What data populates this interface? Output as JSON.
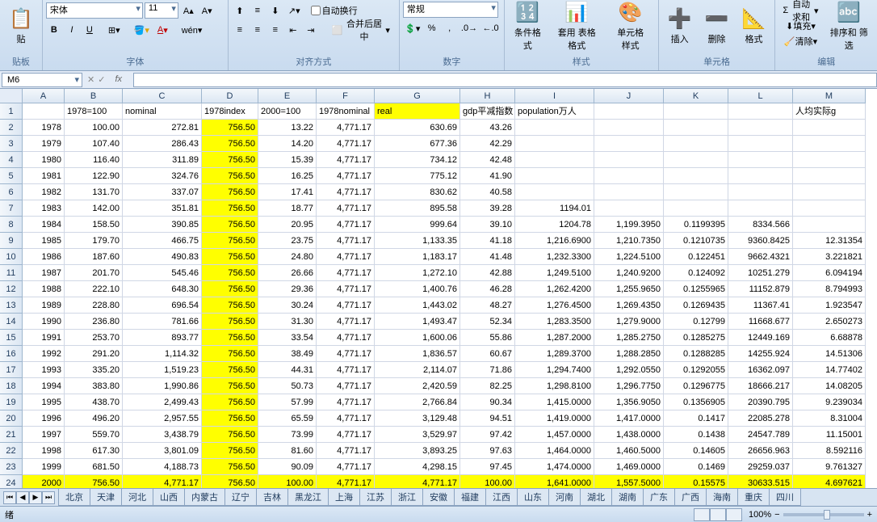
{
  "ribbon": {
    "clipboard": {
      "paste": "贴",
      "group": "贴板"
    },
    "font": {
      "name": "宋体",
      "size": "11",
      "group": "字体"
    },
    "alignment": {
      "wrap": "自动换行",
      "merge": "合并后居中",
      "group": "对齐方式"
    },
    "number": {
      "format": "常规",
      "group": "数字"
    },
    "styles": {
      "cond": "条件格式",
      "table": "套用\n表格格式",
      "cell": "单元格\n样式",
      "group": "样式"
    },
    "cells": {
      "insert": "插入",
      "delete": "删除",
      "format": "格式",
      "group": "单元格"
    },
    "editing": {
      "autosum": "自动求和",
      "fill": "填充",
      "clear": "清除",
      "sort": "排序和\n筛选",
      "group": "编辑"
    }
  },
  "namebox": "M6",
  "columns": [
    "A",
    "B",
    "C",
    "D",
    "E",
    "F",
    "G",
    "H",
    "I",
    "J",
    "K",
    "L",
    "M"
  ],
  "colwidths": [
    "colA",
    "colB",
    "colC",
    "colD",
    "colE",
    "colF",
    "colG",
    "colH",
    "colI",
    "colJ",
    "colK",
    "colL",
    "colM"
  ],
  "headers": {
    "B": "1978=100",
    "C": "nominal",
    "D": "1978index",
    "E": "2000=100",
    "F": "1978nominal",
    "G": "real",
    "H": "gdp平减指数",
    "I": "population万人",
    "M": "人均实际g"
  },
  "highlight_cols": [
    "D"
  ],
  "highlight_header_cols": [
    "G"
  ],
  "highlight_last_row": true,
  "rows": [
    {
      "A": "1978",
      "B": "100.00",
      "C": "272.81",
      "D": "756.50",
      "E": "13.22",
      "F": "4,771.17",
      "G": "630.69",
      "H": "43.26"
    },
    {
      "A": "1979",
      "B": "107.40",
      "C": "286.43",
      "D": "756.50",
      "E": "14.20",
      "F": "4,771.17",
      "G": "677.36",
      "H": "42.29"
    },
    {
      "A": "1980",
      "B": "116.40",
      "C": "311.89",
      "D": "756.50",
      "E": "15.39",
      "F": "4,771.17",
      "G": "734.12",
      "H": "42.48"
    },
    {
      "A": "1981",
      "B": "122.90",
      "C": "324.76",
      "D": "756.50",
      "E": "16.25",
      "F": "4,771.17",
      "G": "775.12",
      "H": "41.90"
    },
    {
      "A": "1982",
      "B": "131.70",
      "C": "337.07",
      "D": "756.50",
      "E": "17.41",
      "F": "4,771.17",
      "G": "830.62",
      "H": "40.58"
    },
    {
      "A": "1983",
      "B": "142.00",
      "C": "351.81",
      "D": "756.50",
      "E": "18.77",
      "F": "4,771.17",
      "G": "895.58",
      "H": "39.28",
      "I": "1194.01"
    },
    {
      "A": "1984",
      "B": "158.50",
      "C": "390.85",
      "D": "756.50",
      "E": "20.95",
      "F": "4,771.17",
      "G": "999.64",
      "H": "39.10",
      "I": "1204.78",
      "J": "1,199.3950",
      "K": "0.1199395",
      "L": "8334.566"
    },
    {
      "A": "1985",
      "B": "179.70",
      "C": "466.75",
      "D": "756.50",
      "E": "23.75",
      "F": "4,771.17",
      "G": "1,133.35",
      "H": "41.18",
      "I": "1,216.6900",
      "J": "1,210.7350",
      "K": "0.1210735",
      "L": "9360.8425",
      "M": "12.31354"
    },
    {
      "A": "1986",
      "B": "187.60",
      "C": "490.83",
      "D": "756.50",
      "E": "24.80",
      "F": "4,771.17",
      "G": "1,183.17",
      "H": "41.48",
      "I": "1,232.3300",
      "J": "1,224.5100",
      "K": "0.122451",
      "L": "9662.4321",
      "M": "3.221821"
    },
    {
      "A": "1987",
      "B": "201.70",
      "C": "545.46",
      "D": "756.50",
      "E": "26.66",
      "F": "4,771.17",
      "G": "1,272.10",
      "H": "42.88",
      "I": "1,249.5100",
      "J": "1,240.9200",
      "K": "0.124092",
      "L": "10251.279",
      "M": "6.094194"
    },
    {
      "A": "1988",
      "B": "222.10",
      "C": "648.30",
      "D": "756.50",
      "E": "29.36",
      "F": "4,771.17",
      "G": "1,400.76",
      "H": "46.28",
      "I": "1,262.4200",
      "J": "1,255.9650",
      "K": "0.1255965",
      "L": "11152.879",
      "M": "8.794993"
    },
    {
      "A": "1989",
      "B": "228.80",
      "C": "696.54",
      "D": "756.50",
      "E": "30.24",
      "F": "4,771.17",
      "G": "1,443.02",
      "H": "48.27",
      "I": "1,276.4500",
      "J": "1,269.4350",
      "K": "0.1269435",
      "L": "11367.41",
      "M": "1.923547"
    },
    {
      "A": "1990",
      "B": "236.80",
      "C": "781.66",
      "D": "756.50",
      "E": "31.30",
      "F": "4,771.17",
      "G": "1,493.47",
      "H": "52.34",
      "I": "1,283.3500",
      "J": "1,279.9000",
      "K": "0.12799",
      "L": "11668.677",
      "M": "2.650273"
    },
    {
      "A": "1991",
      "B": "253.70",
      "C": "893.77",
      "D": "756.50",
      "E": "33.54",
      "F": "4,771.17",
      "G": "1,600.06",
      "H": "55.86",
      "I": "1,287.2000",
      "J": "1,285.2750",
      "K": "0.1285275",
      "L": "12449.169",
      "M": "6.68878"
    },
    {
      "A": "1992",
      "B": "291.20",
      "C": "1,114.32",
      "D": "756.50",
      "E": "38.49",
      "F": "4,771.17",
      "G": "1,836.57",
      "H": "60.67",
      "I": "1,289.3700",
      "J": "1,288.2850",
      "K": "0.1288285",
      "L": "14255.924",
      "M": "14.51306"
    },
    {
      "A": "1993",
      "B": "335.20",
      "C": "1,519.23",
      "D": "756.50",
      "E": "44.31",
      "F": "4,771.17",
      "G": "2,114.07",
      "H": "71.86",
      "I": "1,294.7400",
      "J": "1,292.0550",
      "K": "0.1292055",
      "L": "16362.097",
      "M": "14.77402"
    },
    {
      "A": "1994",
      "B": "383.80",
      "C": "1,990.86",
      "D": "756.50",
      "E": "50.73",
      "F": "4,771.17",
      "G": "2,420.59",
      "H": "82.25",
      "I": "1,298.8100",
      "J": "1,296.7750",
      "K": "0.1296775",
      "L": "18666.217",
      "M": "14.08205"
    },
    {
      "A": "1995",
      "B": "438.70",
      "C": "2,499.43",
      "D": "756.50",
      "E": "57.99",
      "F": "4,771.17",
      "G": "2,766.84",
      "H": "90.34",
      "I": "1,415.0000",
      "J": "1,356.9050",
      "K": "0.1356905",
      "L": "20390.795",
      "M": "9.239034"
    },
    {
      "A": "1996",
      "B": "496.20",
      "C": "2,957.55",
      "D": "756.50",
      "E": "65.59",
      "F": "4,771.17",
      "G": "3,129.48",
      "H": "94.51",
      "I": "1,419.0000",
      "J": "1,417.0000",
      "K": "0.1417",
      "L": "22085.278",
      "M": "8.31004"
    },
    {
      "A": "1997",
      "B": "559.70",
      "C": "3,438.79",
      "D": "756.50",
      "E": "73.99",
      "F": "4,771.17",
      "G": "3,529.97",
      "H": "97.42",
      "I": "1,457.0000",
      "J": "1,438.0000",
      "K": "0.1438",
      "L": "24547.789",
      "M": "11.15001"
    },
    {
      "A": "1998",
      "B": "617.30",
      "C": "3,801.09",
      "D": "756.50",
      "E": "81.60",
      "F": "4,771.17",
      "G": "3,893.25",
      "H": "97.63",
      "I": "1,464.0000",
      "J": "1,460.5000",
      "K": "0.14605",
      "L": "26656.963",
      "M": "8.592116"
    },
    {
      "A": "1999",
      "B": "681.50",
      "C": "4,188.73",
      "D": "756.50",
      "E": "90.09",
      "F": "4,771.17",
      "G": "4,298.15",
      "H": "97.45",
      "I": "1,474.0000",
      "J": "1,469.0000",
      "K": "0.1469",
      "L": "29259.037",
      "M": "9.761327"
    },
    {
      "A": "2000",
      "B": "756.50",
      "C": "4,771.17",
      "D": "756.50",
      "E": "100.00",
      "F": "4,771.17",
      "G": "4,771.17",
      "H": "100.00",
      "I": "1,641.0000",
      "J": "1,557.5000",
      "K": "0.15575",
      "L": "30633.515",
      "M": "4.697621"
    }
  ],
  "sheets": [
    "北京",
    "天津",
    "河北",
    "山西",
    "内蒙古",
    "辽宁",
    "吉林",
    "黑龙江",
    "上海",
    "江苏",
    "浙江",
    "安徽",
    "福建",
    "江西",
    "山东",
    "河南",
    "湖北",
    "湖南",
    "广东",
    "广西",
    "海南",
    "重庆",
    "四川"
  ],
  "status": {
    "ready": "绪",
    "zoom": "100%"
  }
}
